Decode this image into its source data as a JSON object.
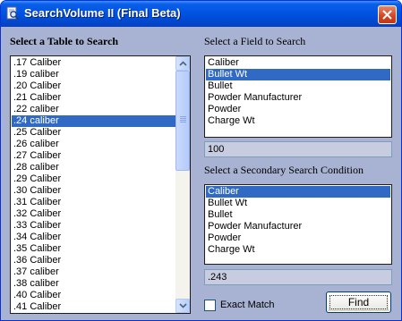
{
  "window": {
    "title": "SearchVolume II (Final Beta)",
    "icons": {
      "app": "search-document-icon",
      "close": "close-icon"
    }
  },
  "table_panel": {
    "label": "Select a Table to Search",
    "items": [
      ".17 Caliber",
      ".19 caliber",
      ".20 Caliber",
      ".21 Caliber",
      ".22 caliber",
      ".24 caliber",
      ".25 Caliber",
      ".26 caliber",
      ".27 Caliber",
      ".28 caliber",
      ".29 Caliber",
      ".30 Caliber",
      ".31 Caliber",
      ".32 Caliber",
      ".33 Caliber",
      ".34 Caliber",
      ".35 Caliber",
      ".36 Caliber",
      ".37 caliber",
      ".38 caliber",
      ".40 Caliber",
      ".41 Caliber"
    ],
    "selected_index": 5
  },
  "field_panel": {
    "label": "Select a Field to Search",
    "items": [
      "Caliber",
      "Bullet Wt",
      "Bullet",
      "Powder Manufacturer",
      "Powder",
      "Charge Wt"
    ],
    "selected_index": 1,
    "value": "100"
  },
  "secondary_panel": {
    "label": "Select a Secondary Search Condition",
    "items": [
      "Caliber",
      "Bullet Wt",
      "Bullet",
      "Powder Manufacturer",
      "Powder",
      "Charge Wt"
    ],
    "selected_index": 0,
    "value": ".243"
  },
  "exact_match": {
    "label": "Exact Match",
    "checked": false
  },
  "find_button": {
    "label": "Find"
  },
  "colors": {
    "selection": "#316ac5",
    "dialog_bg": "#a8b2d2",
    "titlebar": "#0054e3"
  }
}
